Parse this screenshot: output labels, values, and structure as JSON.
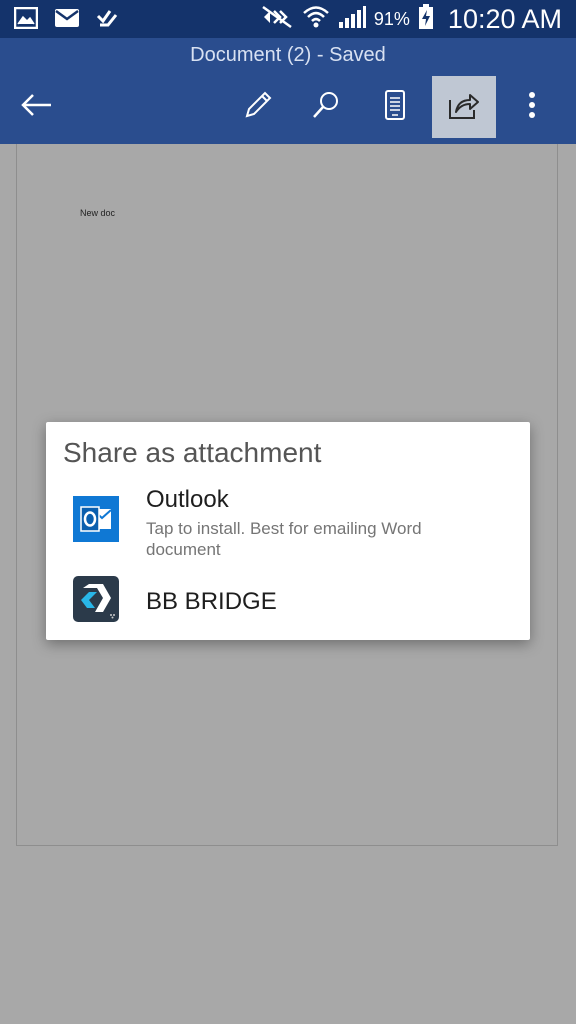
{
  "status_bar": {
    "battery": "91%",
    "time": "10:20 AM",
    "left_icons": [
      "gallery-icon",
      "email-icon",
      "task-icon"
    ],
    "right_icons": [
      "mute-icon",
      "wifi-icon",
      "signal-icon",
      "battery-charging-icon"
    ]
  },
  "app_bar": {
    "title": "Document (2) - Saved",
    "toolbar": [
      "back-arrow-icon",
      "edit-pencil-icon",
      "search-icon",
      "mobile-view-icon",
      "share-icon",
      "more-vertical-icon"
    ],
    "active_button": "share-icon"
  },
  "document": {
    "text": "New doc"
  },
  "dialog": {
    "title": "Share as attachment",
    "items": [
      {
        "name": "Outlook",
        "description": "Tap to install. Best for emailing Word document",
        "icon": "outlook-icon",
        "color": "#0f78d4"
      },
      {
        "name": "BB BRIDGE",
        "icon": "bb-bridge-icon",
        "color": "#2b3a4a"
      }
    ]
  },
  "colors": {
    "status_bar": "#14336b",
    "app_bar": "#2a4d8e",
    "background": "#a8a8a8"
  }
}
